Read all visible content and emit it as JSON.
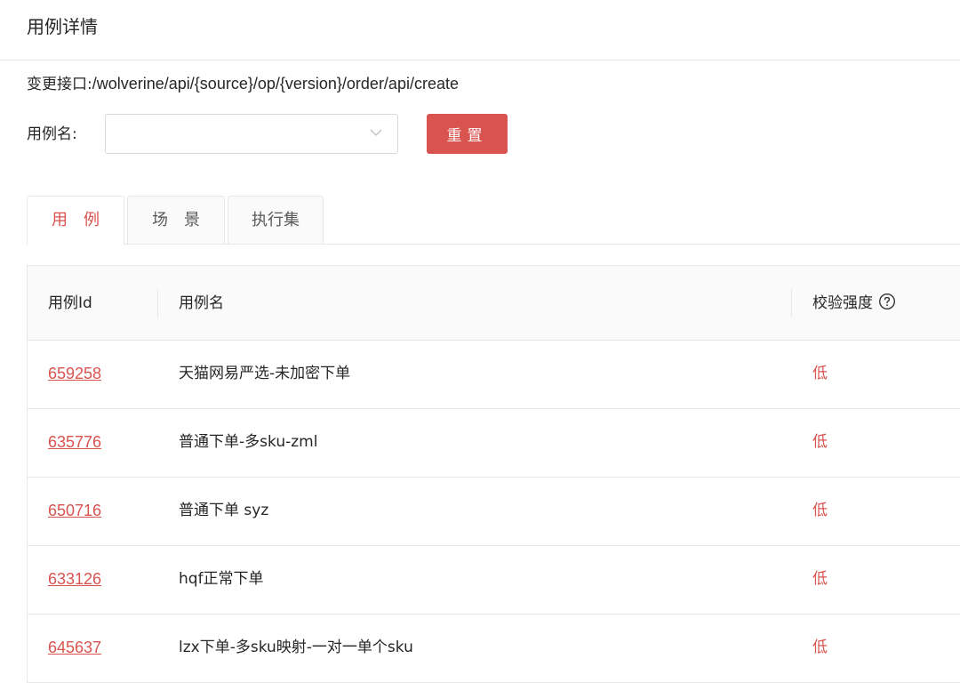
{
  "header": {
    "title": "用例详情"
  },
  "api": {
    "label": "变更接口:",
    "path": "/wolverine/api/{source}/op/{version}/order/api/create"
  },
  "filter": {
    "name_label": "用例名:",
    "select_value": "",
    "reset_label": "重置"
  },
  "tabs": [
    {
      "label": "用例",
      "active": true
    },
    {
      "label": "场景",
      "active": false
    },
    {
      "label": "执行集",
      "active": false
    }
  ],
  "table": {
    "columns": {
      "id": "用例Id",
      "name": "用例名",
      "level": "校验强度"
    },
    "rows": [
      {
        "id": "659258",
        "name": "天猫网易严选-未加密下单",
        "level": "低"
      },
      {
        "id": "635776",
        "name": "普通下单-多sku-zml",
        "level": "低"
      },
      {
        "id": "650716",
        "name": "普通下单 syz",
        "level": "低"
      },
      {
        "id": "633126",
        "name": "hqf正常下单",
        "level": "低"
      },
      {
        "id": "645637",
        "name": "lzx下单-多sku映射-一对一单个sku",
        "level": "低"
      }
    ]
  },
  "colors": {
    "accent": "#d9534f",
    "border": "#e8e8e8",
    "header_bg": "#fafafa"
  },
  "icons": {
    "select_arrow": "chevron-down-icon",
    "help": "question-circle-icon"
  }
}
